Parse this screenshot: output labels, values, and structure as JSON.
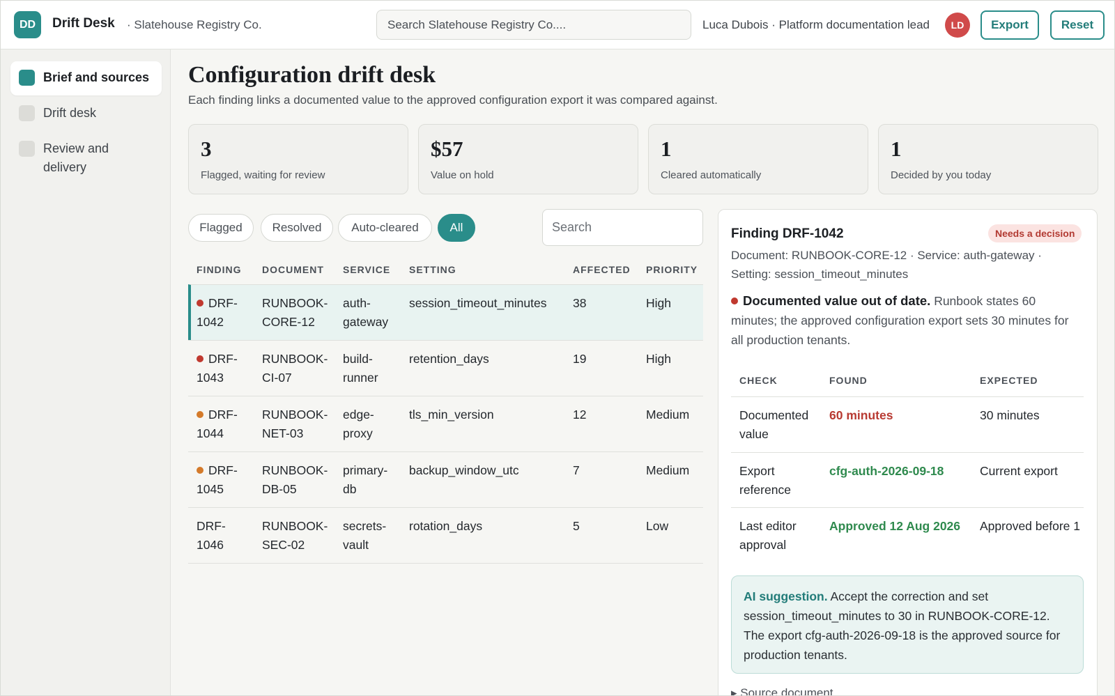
{
  "header": {
    "logo_initials": "DD",
    "app_name": "Drift Desk",
    "org_name": "· Slatehouse Registry Co.",
    "search_placeholder": "Search Slatehouse Registry Co....",
    "user_label": "Luca Dubois · Platform documentation lead",
    "avatar_initials": "LD",
    "export_label": "Export",
    "reset_label": "Reset"
  },
  "sidebar": {
    "items": [
      {
        "label": "Brief and sources",
        "active": true
      },
      {
        "label": "Drift desk",
        "active": false
      },
      {
        "label": "Review and delivery",
        "active": false
      }
    ]
  },
  "main": {
    "title": "Configuration drift desk",
    "subtitle": "Each finding links a documented value to the approved configuration export it was compared against.",
    "stats": [
      {
        "value": "3",
        "label": "Flagged, waiting for review"
      },
      {
        "value": "$57",
        "label": "Value on hold"
      },
      {
        "value": "1",
        "label": "Cleared automatically"
      },
      {
        "value": "1",
        "label": "Decided by you today"
      }
    ],
    "filters": [
      {
        "label": "Flagged",
        "active": false
      },
      {
        "label": "Resolved",
        "active": false
      },
      {
        "label": "Auto-cleared",
        "active": false
      },
      {
        "label": "All",
        "active": true
      }
    ],
    "search_placeholder": "Search"
  },
  "table": {
    "headers": [
      "FINDING",
      "DOCUMENT",
      "SERVICE",
      "SETTING",
      "AFFECTED",
      "PRIORITY"
    ],
    "rows": [
      {
        "finding": "DRF-1042",
        "document": "RUNBOOK-CORE-12",
        "service": "auth-gateway",
        "setting": "session_timeout_minutes",
        "affected": "38",
        "priority": "High",
        "dot": "high",
        "selected": true
      },
      {
        "finding": "DRF-1043",
        "document": "RUNBOOK-CI-07",
        "service": "build-runner",
        "setting": "retention_days",
        "affected": "19",
        "priority": "High",
        "dot": "high",
        "selected": false
      },
      {
        "finding": "DRF-1044",
        "document": "RUNBOOK-NET-03",
        "service": "edge-proxy",
        "setting": "tls_min_version",
        "affected": "12",
        "priority": "Medium",
        "dot": "medium",
        "selected": false
      },
      {
        "finding": "DRF-1045",
        "document": "RUNBOOK-DB-05",
        "service": "primary-db",
        "setting": "backup_window_utc",
        "affected": "7",
        "priority": "Medium",
        "dot": "medium",
        "selected": false
      },
      {
        "finding": "DRF-1046",
        "document": "RUNBOOK-SEC-02",
        "service": "secrets-vault",
        "setting": "rotation_days",
        "affected": "5",
        "priority": "Low",
        "dot": "",
        "selected": false
      }
    ]
  },
  "detail": {
    "title": "Finding DRF-1042",
    "badge": "Needs a decision",
    "meta": "Document: RUNBOOK-CORE-12 · Service: auth-gateway · Setting: session_timeout_minutes",
    "headline": "Documented value out of date.",
    "description": "Runbook states 60 minutes; the approved configuration export sets 30 minutes for all production tenants.",
    "check_headers": [
      "CHECK",
      "FOUND",
      "EXPECTED"
    ],
    "checks": [
      {
        "check": "Documented value",
        "found": "60 minutes",
        "expected": "30 minutes",
        "status": "bad"
      },
      {
        "check": "Export reference",
        "found": "cfg-auth-2026-09-18",
        "expected": "Current export",
        "status": "good"
      },
      {
        "check": "Last editor approval",
        "found": "Approved 12 Aug 2026",
        "expected": "Approved before 1",
        "status": "good"
      }
    ],
    "suggestion_label": "AI suggestion.",
    "suggestion_text": "Accept the correction and set session_timeout_minutes to 30 in RUNBOOK-CORE-12. The export cfg-auth-2026-09-18 is the approved source for production tenants.",
    "source_doc": "▸ Source document"
  },
  "colors": {
    "accent": "#2a8d8a",
    "danger": "#c0392f",
    "warning": "#d47a2a",
    "success": "#2f8a4e"
  }
}
